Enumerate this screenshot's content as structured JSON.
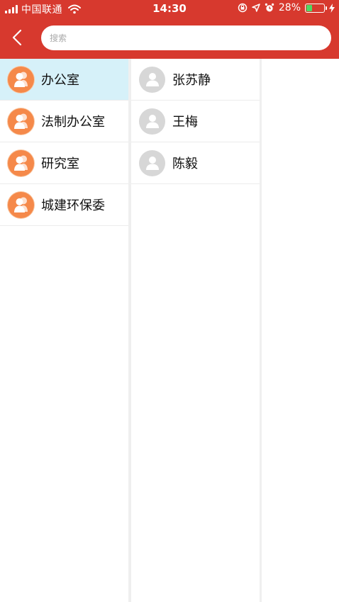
{
  "status_bar": {
    "carrier": "中国联通",
    "time": "14:30",
    "battery_percent": "28%",
    "battery_level": 0.28,
    "icons": [
      "signal-icon",
      "wifi-icon",
      "orientation-lock-icon",
      "location-icon",
      "alarm-icon",
      "battery-icon",
      "charging-icon"
    ]
  },
  "header": {
    "back_icon": "chevron-left-icon",
    "search_placeholder": "搜索",
    "background_color": "#d7392e"
  },
  "departments": [
    {
      "label": "办公室",
      "selected": true
    },
    {
      "label": "法制办公室",
      "selected": false
    },
    {
      "label": "研究室",
      "selected": false
    },
    {
      "label": "城建环保委",
      "selected": false
    }
  ],
  "members": [
    {
      "label": "张苏静"
    },
    {
      "label": "王梅"
    },
    {
      "label": "陈毅"
    }
  ],
  "colors": {
    "selected_row": "#d6f1f9",
    "group_avatar": "#f5894a",
    "person_avatar": "#d7d7d7"
  }
}
